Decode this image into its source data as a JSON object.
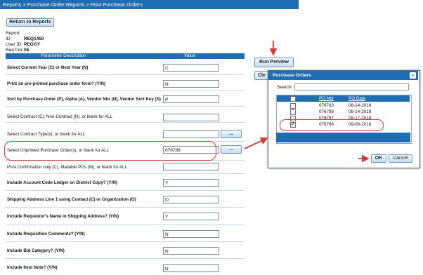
{
  "breadcrumb": "Reports > Purchase Order Reports > Print Purchase Orders",
  "return_button": "Return to Reports",
  "info": [
    {
      "key": "Report ID:",
      "value": "REQ1450"
    },
    {
      "key": "User ID:",
      "value": "PEGGY"
    },
    {
      "key": "Req Per:",
      "value": "06"
    }
  ],
  "table": {
    "col_param": "Parameter Description",
    "col_value": "Value",
    "rows": [
      {
        "label": "Select Current Year (C) or Next Year (N)",
        "value": "C",
        "bold": true
      },
      {
        "label": "Print on pre-printed purchase order form? (Y/N)",
        "value": "N",
        "bold": true
      },
      {
        "label": "Sort by Purchase Order (P), Alpha (A), Vendor Nbr (N), Vendor Sort Key (S)",
        "value": "P",
        "bold": true
      },
      {
        "label": "Select Contract (C), Non-Contract (N), or blank for ALL",
        "value": "",
        "bold": false
      },
      {
        "label": "Select Contract Type(s), or blank for ALL",
        "value": "",
        "bold": false,
        "lookup": "..."
      },
      {
        "label": "Select Unprinted Purchase Order(s), or blank for ALL",
        "value": "076788",
        "bold": false,
        "lookup": "..."
      },
      {
        "label": "Print Confirmation only (C), Mailable POs (M), or blank for ALL",
        "value": "",
        "bold": false
      },
      {
        "label": "Include Account Code Ledger on District Copy? (Y/N)",
        "value": "Y",
        "bold": true
      },
      {
        "label": "Shipping Address Line 1 using Contact (C) or Organization (O)",
        "value": "O",
        "bold": true
      },
      {
        "label": "Include Requestor's Name in Shipping Address? (Y/N)",
        "value": "Y",
        "bold": true
      },
      {
        "label": "Include Requisition Comments? (Y/N)",
        "value": "N",
        "bold": true
      },
      {
        "label": "Include Bid Category? (Y/N)",
        "value": "N",
        "bold": true
      },
      {
        "label": "Include Item Note? (Y/N)",
        "value": "N",
        "bold": true
      }
    ]
  },
  "run_preview_button": "Run Preview",
  "clear_button_partial": "Cle",
  "dialog": {
    "title": "Purchase Orders",
    "close": "×",
    "search_label": "Search:",
    "col_po": "PO Nbr",
    "col_date": "PO Date",
    "rows": [
      {
        "po": "076783",
        "date": "08-14-2018",
        "checked": false
      },
      {
        "po": "076786",
        "date": "08-14-2018",
        "checked": false
      },
      {
        "po": "076787",
        "date": "08-17-2018",
        "checked": false
      },
      {
        "po": "076788",
        "date": "09-06-2018",
        "checked": true
      }
    ],
    "ok": "OK",
    "cancel": "Cancel"
  },
  "colors": {
    "accent": "#1f6db3",
    "highlight": "#d23a3a"
  }
}
